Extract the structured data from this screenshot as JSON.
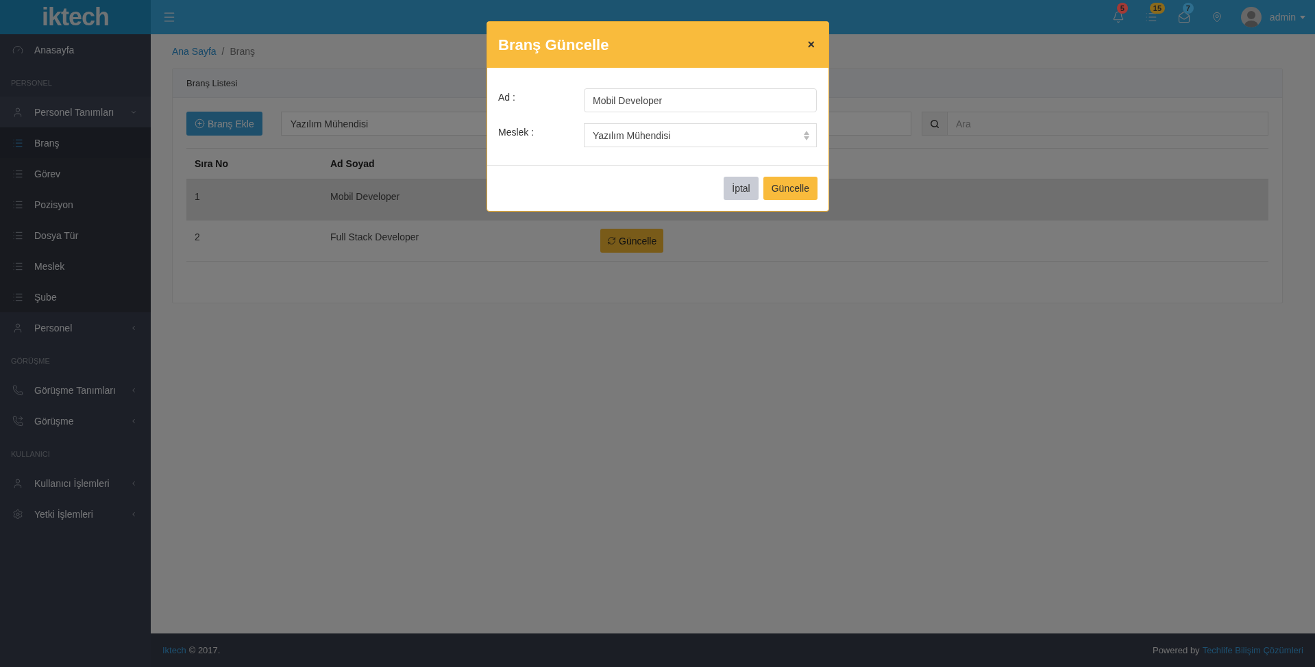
{
  "header": {
    "logo": "iktech",
    "notifications": [
      {
        "kind": "bell",
        "count": "5",
        "color": "#a33a35"
      },
      {
        "kind": "tasks",
        "count": "15",
        "color": "#8b6a1b"
      },
      {
        "kind": "mail",
        "count": "7",
        "color": "#2e6e8e"
      }
    ],
    "user": {
      "name": "admin"
    }
  },
  "sidebar": {
    "items": [
      {
        "kind": "dashboard",
        "label": "Anasayfa",
        "selected": false
      },
      {
        "kind": "heading",
        "label": "PERSONEL"
      },
      {
        "kind": "user",
        "label": "Personel Tanımları",
        "selected": false,
        "expanded": true,
        "children": [
          {
            "kind": "list",
            "label": "Branş",
            "selected": true
          },
          {
            "kind": "list",
            "label": "Görev",
            "selected": false
          },
          {
            "kind": "list",
            "label": "Pozisyon",
            "selected": false
          },
          {
            "kind": "list",
            "label": "Dosya Tür",
            "selected": false
          },
          {
            "kind": "list",
            "label": "Meslek",
            "selected": false
          },
          {
            "kind": "list",
            "label": "Şube",
            "selected": false
          }
        ]
      },
      {
        "kind": "user",
        "label": "Personel",
        "selected": false,
        "expanded": false
      },
      {
        "kind": "heading",
        "label": "GÖRÜŞME"
      },
      {
        "kind": "phone",
        "label": "Görüşme Tanımları",
        "selected": false,
        "expanded": false
      },
      {
        "kind": "callback",
        "label": "Görüşme",
        "selected": false,
        "expanded": false
      },
      {
        "kind": "heading",
        "label": "KULLANICI"
      },
      {
        "kind": "user",
        "label": "Kullanıcı İşlemleri",
        "selected": false,
        "expanded": false
      },
      {
        "kind": "gear",
        "label": "Yetki İşlemleri",
        "selected": false,
        "expanded": false
      }
    ]
  },
  "breadcrumb": {
    "items": [
      "Ana Sayfa",
      "Branş"
    ],
    "separator": "/"
  },
  "card": {
    "title": "Branş Listesi",
    "add_button": "Branş Ekle",
    "filter": {
      "value": "Yazılım Mühendisi"
    },
    "search": {
      "placeholder": "Ara"
    },
    "table": {
      "columns": [
        "Sıra No",
        "Ad Soyad"
      ],
      "rows": [
        {
          "cells": [
            "1",
            "Mobil Developer"
          ],
          "highlighted": true
        },
        {
          "cells": [
            "2",
            "Full Stack Developer"
          ],
          "highlighted": false,
          "action": "Güncelle"
        }
      ]
    }
  },
  "modal": {
    "title": "Branş Güncelle",
    "close": "×",
    "fields": [
      {
        "kind": "text",
        "label": "Ad :",
        "value": "Mobil Developer"
      },
      {
        "kind": "select",
        "label": "Meslek :",
        "value": "Yazılım Mühendisi"
      }
    ],
    "buttons": [
      {
        "kind": "secondary",
        "label": "İptal"
      },
      {
        "kind": "primary",
        "label": "Güncelle"
      }
    ]
  },
  "footer": {
    "brand": "Iktech",
    "copyright": "© 2017.",
    "powered": "Powered by",
    "company": "Techlife Bilişim Çözümleri"
  }
}
